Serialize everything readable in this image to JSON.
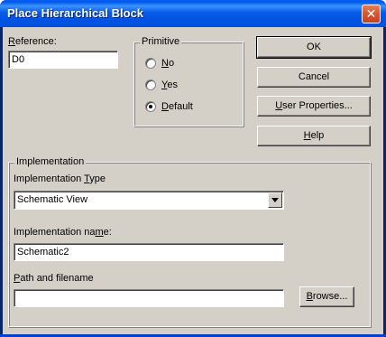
{
  "window": {
    "title": "Place Hierarchical Block",
    "close_glyph": "✕"
  },
  "reference": {
    "label_u": "R",
    "label_rest": "eference:",
    "value": "D0"
  },
  "primitive": {
    "title": "Primitive",
    "options": [
      {
        "label_u": "N",
        "label_rest": "o",
        "selected": false
      },
      {
        "label_u": "Y",
        "label_rest": "es",
        "selected": false
      },
      {
        "label_u": "D",
        "label_rest": "efault",
        "selected": true
      }
    ]
  },
  "buttons": {
    "ok": "OK",
    "cancel": "Cancel",
    "user_properties_u": "U",
    "user_properties_rest": "ser Properties...",
    "help_u": "H",
    "help_rest": "elp",
    "browse_u": "B",
    "browse_rest": "rowse..."
  },
  "implementation": {
    "title": "Implementation",
    "type_label_pre": "Implementation ",
    "type_label_u": "T",
    "type_label_rest": "ype",
    "type_value": "Schematic View",
    "name_label_pre": "Implementation na",
    "name_label_u": "m",
    "name_label_rest": "e:",
    "name_value": "Schematic2",
    "path_label_u": "P",
    "path_label_rest": "ath and filename",
    "path_value": ""
  }
}
